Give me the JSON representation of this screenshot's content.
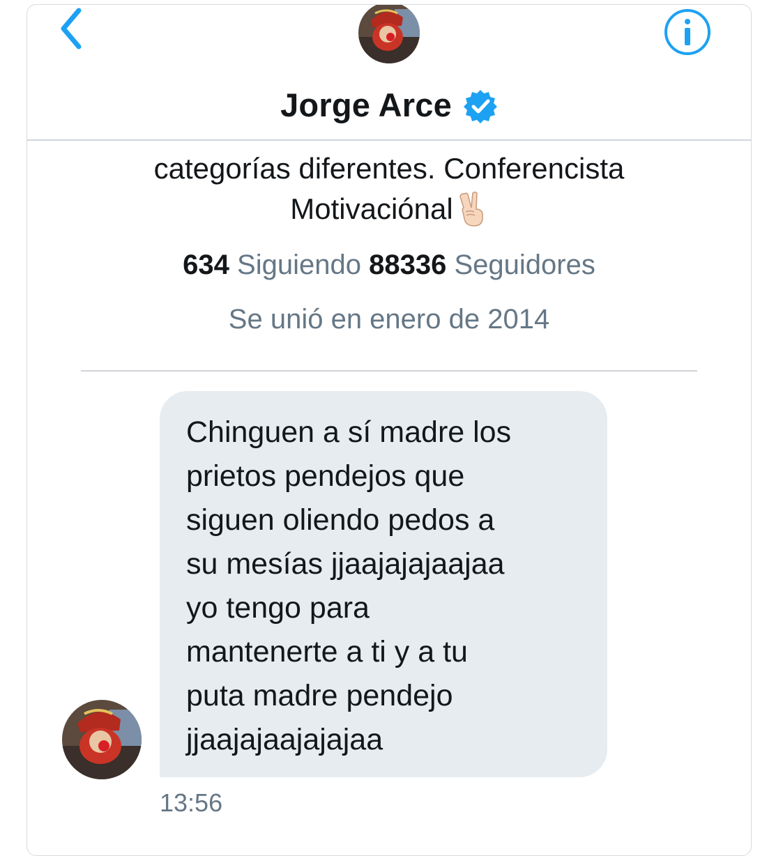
{
  "header": {
    "title": "Jorge Arce",
    "back_icon": "chevron-left-icon",
    "info_icon": "info-icon",
    "verified_icon": "verified-badge-icon",
    "accent_color": "#1da1f2"
  },
  "profile": {
    "bio_line1": "categorías diferentes. Conferencista",
    "bio_line2": "Motivaciónal",
    "bio_emoji": "victory-hand-emoji",
    "following_count": "634",
    "following_label": "Siguiendo",
    "followers_count": "88336",
    "followers_label": "Seguidores",
    "joined": "Se unió en enero de 2014"
  },
  "conversation": {
    "messages": [
      {
        "lines": [
          "Chinguen a sí madre los",
          "prietos pendejos que",
          "siguen oliendo pedos a",
          "su mesías jjaajajajaajaa",
          "yo tengo para",
          "mantenerte a ti y a tu",
          "puta madre pendejo",
          "jjaajajaajajajaa"
        ],
        "time": "13:56"
      }
    ]
  }
}
